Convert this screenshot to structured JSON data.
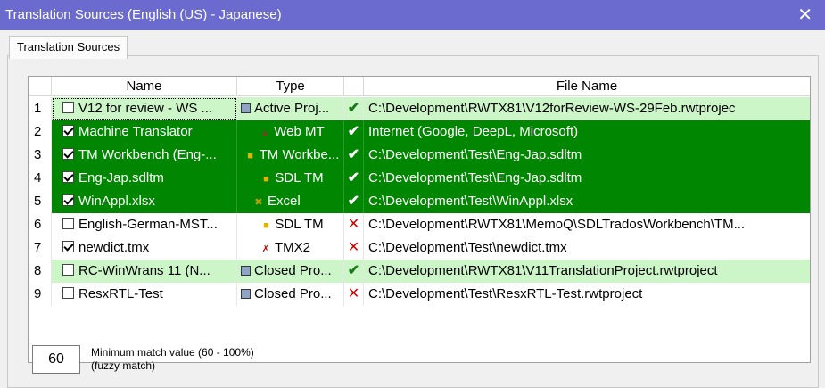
{
  "window": {
    "title": "Translation Sources (English (US) - Japanese)",
    "close": "✕"
  },
  "tabs": [
    {
      "label": "Translation Sources"
    }
  ],
  "table": {
    "columns": {
      "name": "Name",
      "type": "Type",
      "file": "File Name"
    },
    "rows": [
      {
        "num": "1",
        "checked": false,
        "name": "V12 for review - WS ...",
        "type_icon": "project-icon",
        "type": "Active Proj...",
        "status": "ok",
        "status_glyph": "✔",
        "file": "C:\\Development\\RWTX81\\V12forReview-WS-29Feb.rwtprojec",
        "style": "lg",
        "selected": true
      },
      {
        "num": "2",
        "checked": true,
        "name": "Machine Translator",
        "type_icon": "web-mt-icon",
        "type": "Web MT",
        "status": "ok",
        "status_glyph": "✔",
        "file": "Internet (Google, DeepL, Microsoft)",
        "style": "g"
      },
      {
        "num": "3",
        "checked": true,
        "name": "TM Workbench (Eng-...",
        "type_icon": "tm-icon",
        "type": "TM Workbe...",
        "status": "ok",
        "status_glyph": "✔",
        "file": "C:\\Development\\Test\\Eng-Jap.sdltm",
        "style": "g"
      },
      {
        "num": "4",
        "checked": true,
        "name": "Eng-Jap.sdltm",
        "type_icon": "tm-icon",
        "type": "SDL TM",
        "status": "ok",
        "status_glyph": "✔",
        "file": "C:\\Development\\Test\\Eng-Jap.sdltm",
        "style": "g"
      },
      {
        "num": "5",
        "checked": true,
        "name": "WinAppl.xlsx",
        "type_icon": "excel-icon",
        "type": "Excel",
        "status": "ok",
        "status_glyph": "✔",
        "file": "C:\\Development\\Test\\WinAppl.xlsx",
        "style": "g"
      },
      {
        "num": "6",
        "checked": false,
        "name": "English-German-MST...",
        "type_icon": "tm-icon",
        "type": "SDL TM",
        "status": "error",
        "status_glyph": "✕",
        "file": "C:\\Development\\RWTX81\\MemoQ\\SDLTradosWorkbench\\TM...",
        "style": "w"
      },
      {
        "num": "7",
        "checked": true,
        "name": "newdict.tmx",
        "type_icon": "tmx-icon",
        "type": "TMX2",
        "status": "error",
        "status_glyph": "✕",
        "file": "C:\\Development\\Test\\newdict.tmx",
        "style": "w"
      },
      {
        "num": "8",
        "checked": false,
        "name": "RC-WinWrans 11 (N...",
        "type_icon": "project-icon",
        "type": "Closed Pro...",
        "status": "ok",
        "status_glyph": "✔",
        "file": "C:\\Development\\RWTX81\\V11TranslationProject.rwtproject",
        "style": "lg"
      },
      {
        "num": "9",
        "checked": false,
        "name": "ResxRTL-Test",
        "type_icon": "project-icon",
        "type": "Closed Pro...",
        "status": "error",
        "status_glyph": "✕",
        "file": "C:\\Development\\Test\\ResxRTL-Test.rwtproject",
        "style": "w"
      }
    ]
  },
  "match": {
    "value": "60",
    "label_line1": "Minimum match value (60 - 100%)",
    "label_line2": "(fuzzy match)"
  },
  "colors": {
    "titlebar": "#6b6acf",
    "active_green": "#008600",
    "light_green": "#ccf5c8",
    "ok": "#1a7a1a",
    "error": "#d00000"
  }
}
